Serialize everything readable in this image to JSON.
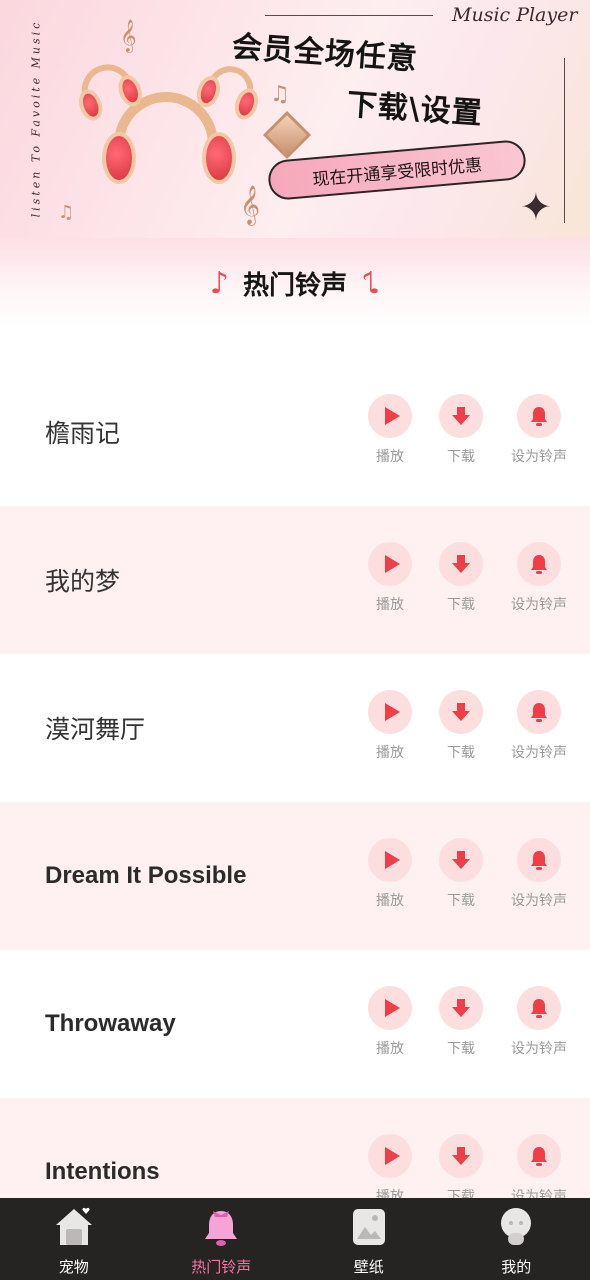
{
  "banner": {
    "brand": "Music Player",
    "side_text": "listen To Favoite Music",
    "headline_line1": "会员全场任意",
    "headline_line2": "下载\\设置",
    "promo": "现在开通享受限时优惠",
    "icons": [
      "headphones-icon",
      "music-clef-icon",
      "diamond-icon",
      "sparkle-icon"
    ]
  },
  "section": {
    "title": "热门铃声",
    "icon": "music-note-icon"
  },
  "actions": {
    "play": "播放",
    "download": "下载",
    "set_ringtone": "设为铃声"
  },
  "songs": [
    {
      "title": "檐雨记"
    },
    {
      "title": "我的梦"
    },
    {
      "title": "漠河舞厅"
    },
    {
      "title": "Dream It Possible"
    },
    {
      "title": "Throwaway"
    },
    {
      "title": "Intentions"
    }
  ],
  "nav": {
    "items": [
      {
        "label": "宠物",
        "icon": "house-icon"
      },
      {
        "label": "热门铃声",
        "icon": "bell-icon",
        "active": true
      },
      {
        "label": "壁纸",
        "icon": "picture-icon"
      },
      {
        "label": "我的",
        "icon": "profile-icon"
      }
    ]
  },
  "colors": {
    "accent": "#ef3e47",
    "action_bg": "#fddede",
    "alt_row": "#fff1f1",
    "nav_bg": "#262323",
    "nav_active": "#ff6fa6"
  }
}
